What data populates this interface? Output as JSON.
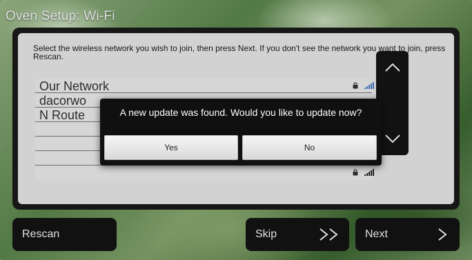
{
  "header": {
    "title": "Oven Setup: Wi-Fi"
  },
  "instructions": "Select the wireless network you wish to join, then press Next. If you don't see the network you want to join, press Rescan.",
  "networks": [
    {
      "name": "Our Network",
      "lock": true,
      "signal": "strong",
      "signal_color": "#4a7bd0"
    },
    {
      "name": "dacorwo",
      "lock": false
    },
    {
      "name": "N Route",
      "lock": false
    },
    {
      "name": "",
      "lock": false
    },
    {
      "name": "",
      "lock": false
    },
    {
      "name": "",
      "lock": true,
      "signal": "strong",
      "signal_color": "#222222"
    }
  ],
  "scroll": {
    "up_icon": "chevron-up-icon",
    "down_icon": "chevron-down-icon"
  },
  "dialog": {
    "message": "A new update was found. Would you like to update now?",
    "yes_label": "Yes",
    "no_label": "No"
  },
  "buttons": {
    "rescan_label": "Rescan",
    "skip_label": "Skip",
    "next_label": "Next"
  }
}
